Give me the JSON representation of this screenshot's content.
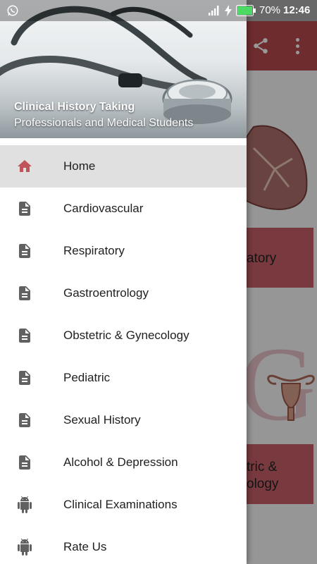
{
  "status_bar": {
    "battery_percent": "70%",
    "time": "12:46",
    "icons": [
      "whatsapp-icon",
      "signal-icon",
      "charging-icon",
      "battery-icon"
    ]
  },
  "background_app": {
    "toolbar_color": "#b94a4f",
    "icons": [
      "share-icon",
      "more-vert-icon"
    ],
    "card_respiratory_partial": "atory",
    "card_obstetric_partial_line1": "tric &",
    "card_obstetric_partial_line2": "ology",
    "big_letter": "G"
  },
  "drawer": {
    "header": {
      "title": "Clinical History Taking",
      "subtitle": "Professionals and Medical Students"
    },
    "items": [
      {
        "label": "Home",
        "icon": "home-icon",
        "selected": true
      },
      {
        "label": "Cardiovascular",
        "icon": "document-icon"
      },
      {
        "label": "Respiratory",
        "icon": "document-icon"
      },
      {
        "label": "Gastroentrology",
        "icon": "document-icon"
      },
      {
        "label": "Obstetric & Gynecology",
        "icon": "document-icon"
      },
      {
        "label": "Pediatric",
        "icon": "document-icon"
      },
      {
        "label": "Sexual History",
        "icon": "document-icon"
      },
      {
        "label": "Alcohol & Depression",
        "icon": "document-icon"
      },
      {
        "label": "Clinical Examinations",
        "icon": "android-icon"
      },
      {
        "label": "Rate Us",
        "icon": "android-icon"
      }
    ],
    "colors": {
      "accent": "#c0545a",
      "icon_gray": "#616161",
      "selected_bg": "#e0e0e0"
    }
  }
}
